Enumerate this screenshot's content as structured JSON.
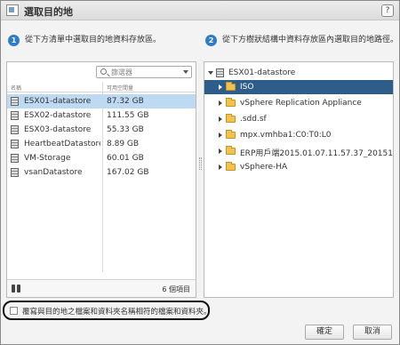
{
  "window": {
    "title": "選取目的地",
    "help_label": "?",
    "title_icon": "dialog-icon"
  },
  "steps": [
    {
      "number": "1",
      "text": "從下方清單中選取目的地資料存放區。"
    },
    {
      "number": "2",
      "text": "從下方樹狀結構中資料存放區內選取目的地路徑。"
    }
  ],
  "datastore_list": {
    "filter_placeholder": "篩選器",
    "columns": [
      "名稱",
      "可用空間量"
    ],
    "rows": [
      {
        "name": "ESX01-datastore",
        "free": "87.32 GB",
        "selected": true
      },
      {
        "name": "ESX02-datastore",
        "free": "111.55 GB"
      },
      {
        "name": "ESX03-datastore",
        "free": "55.33 GB"
      },
      {
        "name": "HeartbeatDatastoreII",
        "free": "8.89 GB"
      },
      {
        "name": "VM-Storage",
        "free": "60.01 GB"
      },
      {
        "name": "vsanDatastore",
        "free": "167.02 GB"
      }
    ],
    "item_count": "6 個項目",
    "footer_icon": "binoculars-icon"
  },
  "folder_tree": {
    "root": "ESX01-datastore",
    "items": [
      {
        "label": "ISO",
        "selected": true
      },
      {
        "label": "vSphere Replication Appliance"
      },
      {
        "label": ".sdd.sf"
      },
      {
        "label": "mpx.vmhba1:C0:T0:L0"
      },
      {
        "label": "ERP用戶端2015.01.07.11.57.37_201517_12"
      },
      {
        "label": "vSphere-HA"
      }
    ]
  },
  "options": {
    "overwrite_label": "覆寫與目的地之檔案和資料夾名稱相符的檔案和資料夾。",
    "overwrite_checked": false
  },
  "buttons": {
    "ok": "確定",
    "cancel": "取消"
  },
  "colors": {
    "accent": "#2f7cc9",
    "list_selection": "#bedaf2",
    "tree_selection": "#2f5d8a",
    "folder": "#f2c24f"
  }
}
